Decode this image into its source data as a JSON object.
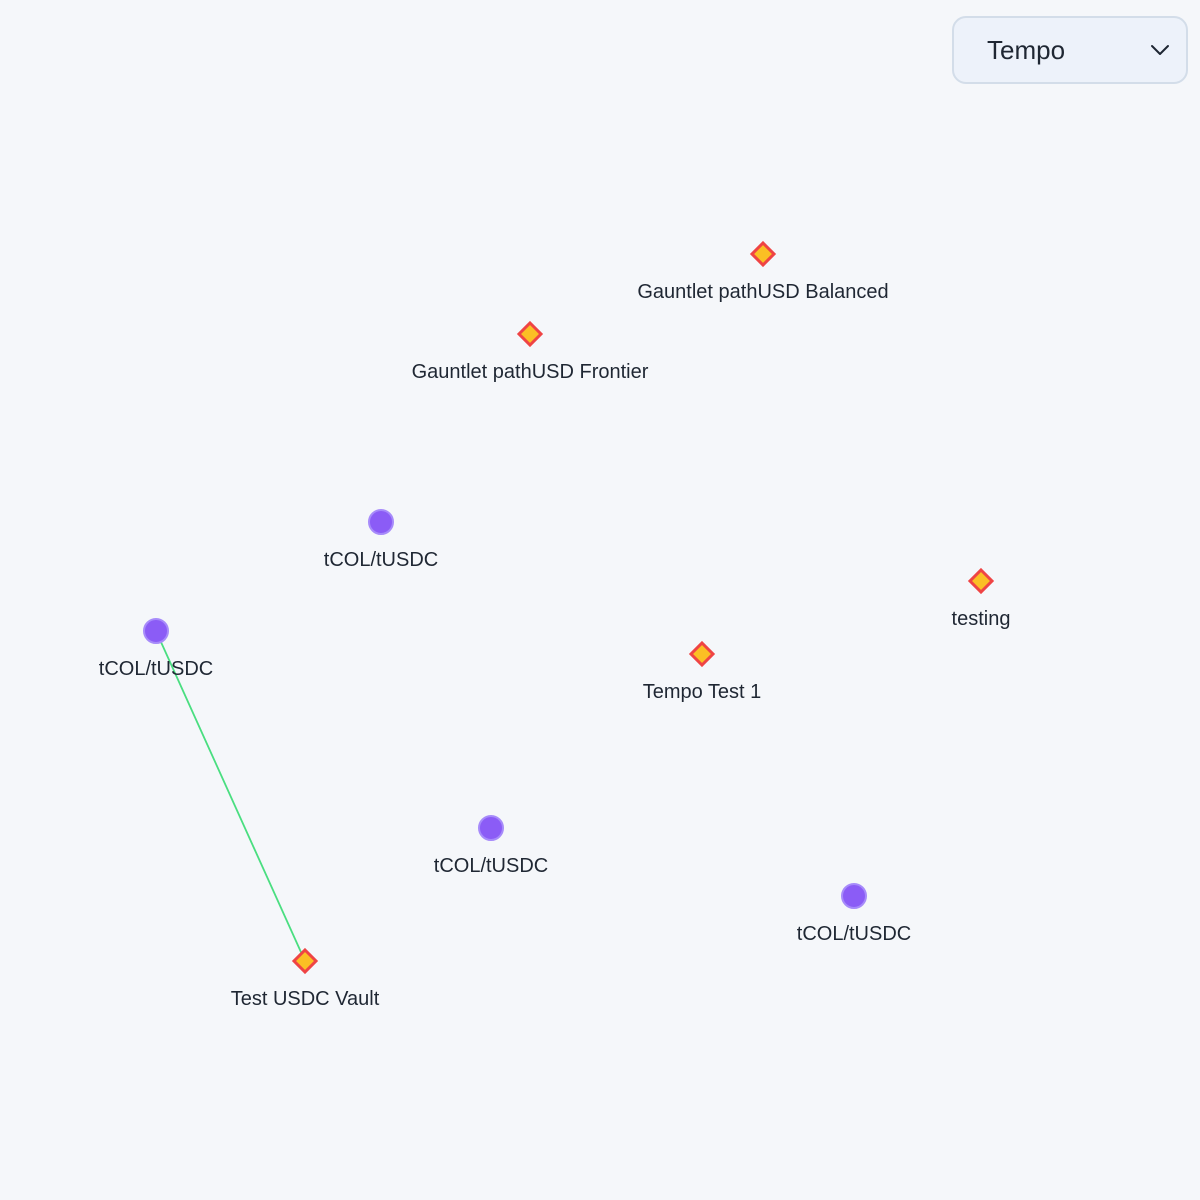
{
  "network_selector": {
    "value": "Tempo",
    "icon": "chevron-down-icon"
  },
  "colors": {
    "background": "#f5f7fa",
    "market_fill": "#8b5cf6",
    "market_stroke": "#a78bfa",
    "vault_fill": "#fbbf24",
    "vault_stroke": "#ef4444",
    "edge": "#4ade80"
  },
  "nodes": [
    {
      "id": "v1",
      "kind": "vault",
      "label": "Gauntlet pathUSD Balanced"
    },
    {
      "id": "v2",
      "kind": "vault",
      "label": "Gauntlet pathUSD Frontier"
    },
    {
      "id": "m1",
      "kind": "market",
      "label": "tCOL/tUSDC"
    },
    {
      "id": "v3",
      "kind": "vault",
      "label": "testing"
    },
    {
      "id": "m2",
      "kind": "market",
      "label": "tCOL/tUSDC"
    },
    {
      "id": "v4",
      "kind": "vault",
      "label": "Tempo Test 1"
    },
    {
      "id": "m3",
      "kind": "market",
      "label": "tCOL/tUSDC"
    },
    {
      "id": "m4",
      "kind": "market",
      "label": "tCOL/tUSDC"
    },
    {
      "id": "v5",
      "kind": "vault",
      "label": "Test USDC Vault"
    }
  ],
  "edges": [
    {
      "source": "m2",
      "target": "v5"
    }
  ]
}
